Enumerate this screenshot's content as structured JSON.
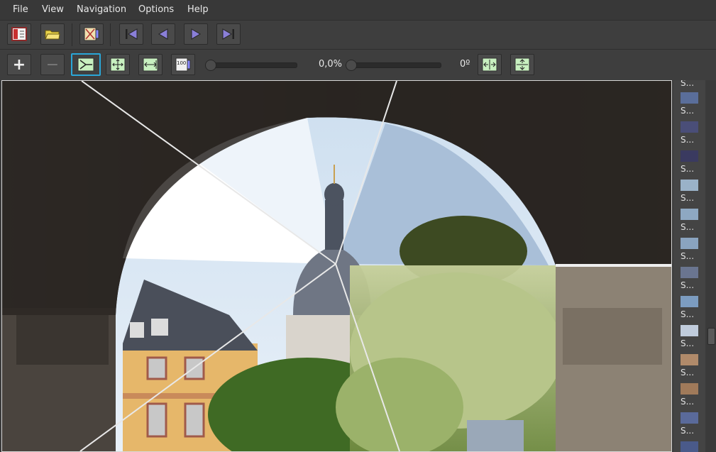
{
  "menu": {
    "file": "File",
    "view": "View",
    "navigation": "Navigation",
    "options": "Options",
    "help": "Help"
  },
  "toolbar2": {
    "zoom_in": "+",
    "zoom_out": "−",
    "zoom_100": "100",
    "zoom_value": "0,0%",
    "rotation_value": "0º"
  },
  "thumbnails": {
    "labels": [
      "S...",
      "S...",
      "S...",
      "S...",
      "S...",
      "S...",
      "S...",
      "S...",
      "S...",
      "S...",
      "S...",
      "S...",
      "S..."
    ]
  },
  "colors": {
    "accent": "#2aa7d8",
    "button_icon_bg": "#c8f0c0",
    "nav_arrow": "#6a5fb8"
  }
}
